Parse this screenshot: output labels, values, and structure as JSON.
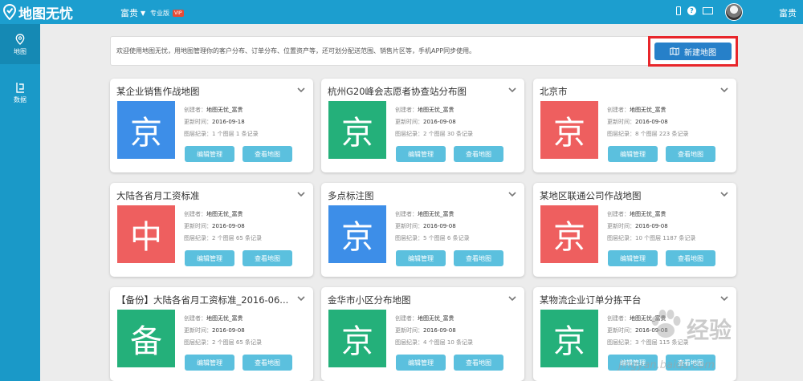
{
  "header": {
    "logo_text": "地图无忧",
    "user_menu": "富贵",
    "edition": "专业版",
    "vip": "VIP",
    "user_name": "富贵"
  },
  "sidebar": {
    "items": [
      {
        "label": "地图",
        "icon": "map-pin-icon"
      },
      {
        "label": "数据",
        "icon": "data-icon"
      }
    ]
  },
  "notice": {
    "text": "欢迎使用地图无忧，用地图管理你的客户分布、订单分布、位置资产等，还可划分配送范围、销售片区等，手机APP同步使用。",
    "new_button": "新建地图"
  },
  "labels": {
    "creator": "创建者：",
    "updated": "更新时间：",
    "records": "图层纪录：",
    "edit": "编辑管理",
    "view": "查看地图"
  },
  "cards": [
    {
      "title": "某企业销售作战地图",
      "char": "京",
      "color": "#3d8ee8",
      "creator": "地图无忧_富贵",
      "updated": "2016-09-18",
      "records": "1 个图层 1 条记录"
    },
    {
      "title": "杭州G20峰会志愿者协查站分布图",
      "char": "京",
      "color": "#24b07a",
      "creator": "地图无忧_富贵",
      "updated": "2016-09-08",
      "records": "2 个图层 30 条记录"
    },
    {
      "title": "北京市",
      "char": "京",
      "color": "#ee5f5f",
      "creator": "地图无忧_富贵",
      "updated": "2016-09-08",
      "records": "8 个图层 223 条记录"
    },
    {
      "title": "大陆各省月工资标准",
      "char": "中",
      "color": "#ee5f5f",
      "creator": "地图无忧_富贵",
      "updated": "2016-09-08",
      "records": "2 个图层 65 条记录"
    },
    {
      "title": "多点标注图",
      "char": "京",
      "color": "#3d8ee8",
      "creator": "地图无忧_富贵",
      "updated": "2016-09-08",
      "records": "5 个图层 6 条记录"
    },
    {
      "title": "某地区联通公司作战地图",
      "char": "京",
      "color": "#ee5f5f",
      "creator": "地图无忧_富贵",
      "updated": "2016-09-08",
      "records": "10 个图层 1187 条记录"
    },
    {
      "title": "【备份】大陆各省月工资标准_2016-06...",
      "char": "备",
      "color": "#24b07a",
      "creator": "地图无忧_富贵",
      "updated": "2016-09-08",
      "records": "2 个图层 65 条记录"
    },
    {
      "title": "金华市小区分布地图",
      "char": "京",
      "color": "#24b07a",
      "creator": "地图无忧_富贵",
      "updated": "2016-09-08",
      "records": "4 个图层 10 条记录"
    },
    {
      "title": "某物流企业订单分拣平台",
      "char": "京",
      "color": "#24b07a",
      "creator": "地图无忧_富贵",
      "updated": "2016-09-08",
      "records": "3 个图层 115 条记录"
    }
  ],
  "watermark": {
    "text": "经验",
    "url": "jingyan.baidu.com"
  }
}
